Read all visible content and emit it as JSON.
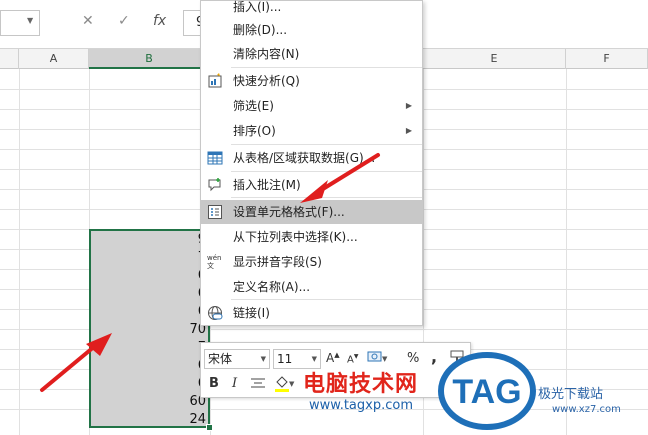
{
  "formula_bar": {
    "cancel_icon": "✕",
    "enter_icon": "✓",
    "fx_label": "fx",
    "value": "9"
  },
  "columns": [
    "A",
    "B",
    "E",
    "F"
  ],
  "cells": [
    "9",
    "7",
    "6",
    "6",
    "6",
    "70",
    "7",
    "6",
    "6",
    "60",
    "24"
  ],
  "context_menu": {
    "insert": "插入(I)...",
    "delete": "删除(D)...",
    "clear": "清除内容(N)",
    "quick_analysis": "快速分析(Q)",
    "filter": "筛选(E)",
    "sort": "排序(O)",
    "get_data": "从表格/区域获取数据(G)...",
    "insert_comment": "插入批注(M)",
    "format_cells": "设置单元格格式(F)...",
    "pick_list": "从下拉列表中选择(K)...",
    "phonetic": "显示拼音字段(S)",
    "define_name": "定义名称(A)...",
    "link": "链接(I)",
    "wen_icon_text": "wén文"
  },
  "mini_toolbar": {
    "font_name": "宋体",
    "font_size": "11",
    "bold": "B",
    "italic": "I",
    "percent": "%",
    "comma": ","
  },
  "watermark": {
    "text": "电脑技术网",
    "url": "www.tagxp.com",
    "logo": "TAG",
    "right_text": "极光下载站",
    "right_url": "www.xz7.com"
  },
  "colors": {
    "excel_green": "#217346",
    "selection_fill": "#d2d2d2",
    "arrow_red": "#e01e1e",
    "watermark_red": "#e1251b",
    "logo_blue": "#1e6fb8"
  }
}
